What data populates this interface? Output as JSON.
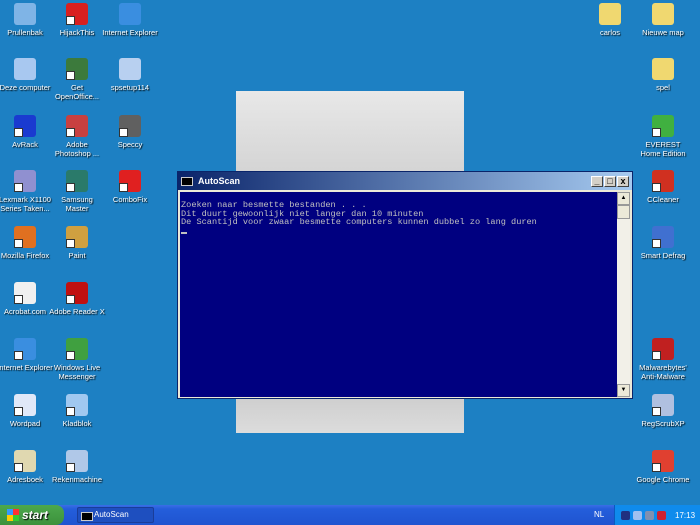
{
  "desktop_icons": [
    {
      "label": "Prullenbak",
      "icon": "recycle-bin-icon",
      "color": "#7fb4e6"
    },
    {
      "label": "HijackThis",
      "icon": "hijackthis-icon",
      "color": "#d82020"
    },
    {
      "label": "Internet Explorer",
      "icon": "internet-explorer-icon",
      "color": "#3a8ee0"
    },
    {
      "label": "Deze computer",
      "icon": "my-computer-icon",
      "color": "#a8c8f0"
    },
    {
      "label": "Get OpenOffice...",
      "icon": "openoffice-icon",
      "color": "#3c7a3c"
    },
    {
      "label": "spsetup114",
      "icon": "setup-icon",
      "color": "#b8d0f0"
    },
    {
      "label": "AvRack",
      "icon": "avrack-icon",
      "color": "#1a3ad0"
    },
    {
      "label": "Adobe Photoshop ...",
      "icon": "photoshop-icon",
      "color": "#c84040"
    },
    {
      "label": "Speccy",
      "icon": "speccy-icon",
      "color": "#606060"
    },
    {
      "label": "Lexmark X1100 Series Taken...",
      "icon": "lexmark-icon",
      "color": "#9090d0"
    },
    {
      "label": "Samsung Master",
      "icon": "samsung-icon",
      "color": "#2a7a6a"
    },
    {
      "label": "ComboFix",
      "icon": "combofix-icon",
      "color": "#e02020"
    },
    {
      "label": "Mozilla Firefox",
      "icon": "firefox-icon",
      "color": "#e07020"
    },
    {
      "label": "Paint",
      "icon": "paint-icon",
      "color": "#d0a040"
    },
    {
      "label": "Acrobat.com",
      "icon": "acrobat-icon",
      "color": "#f0f0f0"
    },
    {
      "label": "Adobe Reader X",
      "icon": "adobe-reader-icon",
      "color": "#c01010"
    },
    {
      "label": "Internet Explorer",
      "icon": "internet-explorer-icon",
      "color": "#3a8ee0"
    },
    {
      "label": "Windows Live Messenger",
      "icon": "messenger-icon",
      "color": "#40a040"
    },
    {
      "label": "Wordpad",
      "icon": "wordpad-icon",
      "color": "#e0e8f8"
    },
    {
      "label": "Kladblok",
      "icon": "notepad-icon",
      "color": "#a0c8f0"
    },
    {
      "label": "Adresboek",
      "icon": "address-book-icon",
      "color": "#e0d8b0"
    },
    {
      "label": "Rekenmachine",
      "icon": "calculator-icon",
      "color": "#b0c8e8"
    },
    {
      "label": "carlos",
      "icon": "folder-icon",
      "color": "#f0d870"
    },
    {
      "label": "Nieuwe map",
      "icon": "folder-icon",
      "color": "#f0d870"
    },
    {
      "label": "spel",
      "icon": "folder-icon",
      "color": "#f0d870"
    },
    {
      "label": "EVEREST Home Edition",
      "icon": "everest-icon",
      "color": "#40b040"
    },
    {
      "label": "CCleaner",
      "icon": "ccleaner-icon",
      "color": "#d03020"
    },
    {
      "label": "Smart Defrag",
      "icon": "smart-defrag-icon",
      "color": "#4070d0"
    },
    {
      "label": "Malwarebytes' Anti-Malware",
      "icon": "malwarebytes-icon",
      "color": "#c02020"
    },
    {
      "label": "RegScrubXP",
      "icon": "regscrub-icon",
      "color": "#b0c0e0"
    },
    {
      "label": "Google Chrome",
      "icon": "chrome-icon",
      "color": "#e04030"
    }
  ],
  "window": {
    "title": "AutoScan",
    "minimize": "_",
    "maximize": "□",
    "close": "x",
    "lines": [
      "Zoeken naar besmette bestanden . . .",
      "Dit duurt gewoonlijk niet langer dan 10 minuten",
      "De Scantijd voor zwaar besmette computers kunnen dubbel zo lang duren"
    ]
  },
  "taskbar": {
    "start": "start",
    "task": "AutoScan",
    "language": "NL",
    "clock": "17:13"
  }
}
